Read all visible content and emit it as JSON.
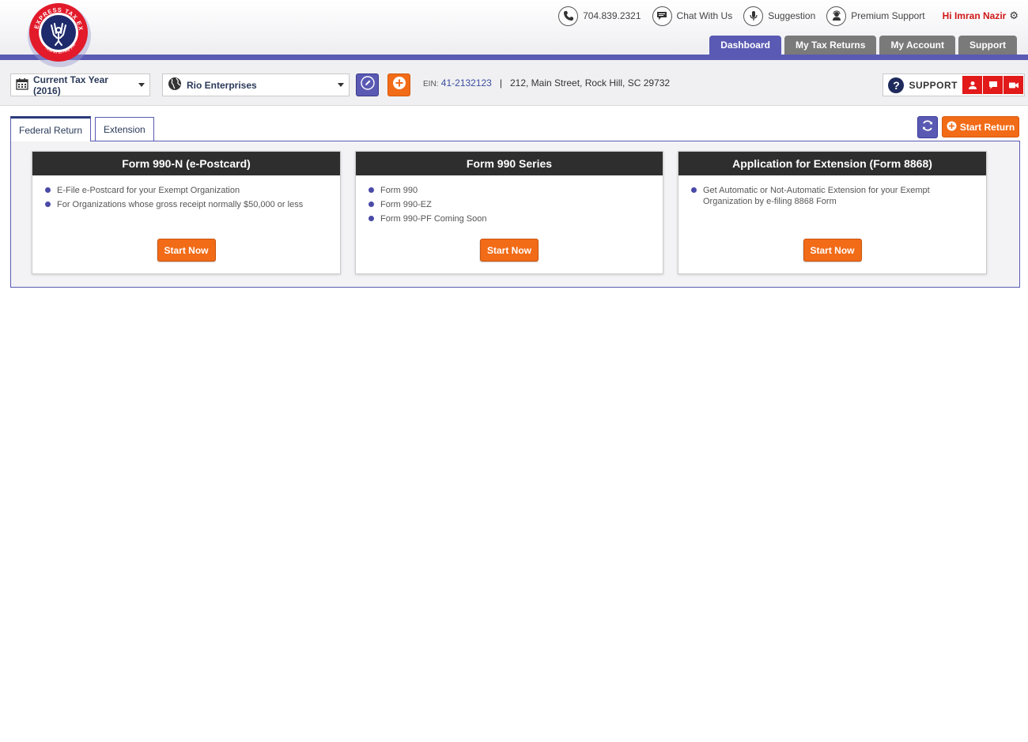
{
  "header": {
    "logo_text": "EXPRESS TAX EXEMPT",
    "logo_tagline": "Now let us help you",
    "phone": "704.839.2321",
    "chat": "Chat With Us",
    "suggestion": "Suggestion",
    "premium_support": "Premium Support",
    "greeting": "Hi Imran Nazir",
    "nav": [
      "Dashboard",
      "My Tax Returns",
      "My Account",
      "Support"
    ]
  },
  "toolbar": {
    "tax_year": "Current Tax Year (2016)",
    "organization": "Rio Enterprises",
    "ein_label": "EIN:",
    "ein": "41-2132123",
    "separator": "|",
    "address": "212, Main Street, Rock Hill, SC 29732",
    "support_label": "SUPPORT"
  },
  "tabs": {
    "federal": "Federal Return",
    "extension": "Extension",
    "start_return": "Start Return"
  },
  "cards": [
    {
      "title": "Form 990-N (e-Postcard)",
      "items": [
        "E-File e-Postcard for your Exempt Organization",
        "For Organizations whose gross receipt normally $50,000 or less"
      ],
      "button": "Start Now"
    },
    {
      "title": "Form 990 Series",
      "items": [
        "Form 990",
        "Form 990-EZ",
        "Form 990-PF Coming Soon"
      ],
      "button": "Start Now"
    },
    {
      "title": "Application for Extension (Form 8868)",
      "items": [
        "Get Automatic or Not-Automatic Extension for your Exempt Organization by e-filing 8868 Form"
      ],
      "button": "Start Now"
    }
  ],
  "colors": {
    "brand_purple": "#5a5ab4",
    "accent_orange": "#f26b17",
    "support_red": "#e21a1a",
    "card_header": "#2e2e2e"
  }
}
